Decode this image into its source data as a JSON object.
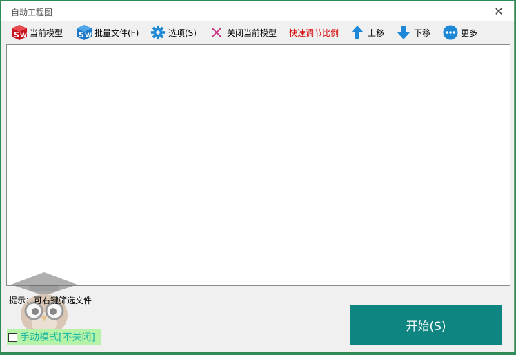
{
  "window": {
    "title": "自动工程图",
    "close_glyph": "✕"
  },
  "toolbar": {
    "items": [
      {
        "label": "当前模型",
        "icon": "solidworks-red-icon"
      },
      {
        "label": "批量文件(F)",
        "icon": "solidworks-blue-icon"
      },
      {
        "label": "选项(S)",
        "icon": "gear-icon"
      },
      {
        "label": "关闭当前模型",
        "icon": "close-x-icon"
      },
      {
        "label": "快速调节比例",
        "icon": "none",
        "color": "#d40000"
      },
      {
        "label": "上移",
        "icon": "arrow-up-icon"
      },
      {
        "label": "下移",
        "icon": "arrow-down-icon"
      },
      {
        "label": "更多",
        "icon": "more-dots-icon"
      }
    ]
  },
  "hint": {
    "text": "提示：可右键筛选文件"
  },
  "manual_mode": {
    "label": "手动模式[不关闭]",
    "checked": false
  },
  "start_button": {
    "label": "开始(S)"
  },
  "colors": {
    "accent": "#0e8581",
    "frame": "#2f8a57",
    "highlight": "#b6f3a8",
    "icon_blue": "#1e88d8",
    "sw_red": "#c8141e"
  }
}
